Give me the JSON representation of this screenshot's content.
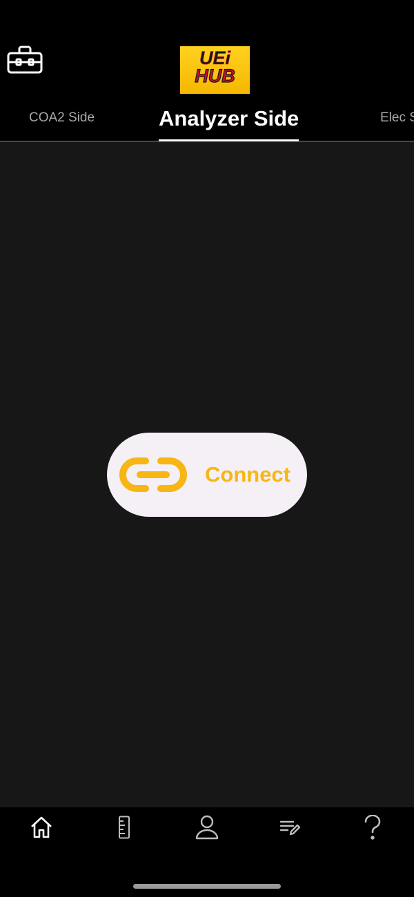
{
  "header": {
    "logo_line1": "UEi",
    "logo_line2": "HUB",
    "toolbox_icon": "toolbox-icon"
  },
  "tabs": [
    {
      "label": "COA2 Side",
      "active": false
    },
    {
      "label": "Analyzer Side",
      "active": true
    },
    {
      "label": "Elec S",
      "active": false
    }
  ],
  "main": {
    "connect_label": "Connect",
    "connect_icon": "link-icon"
  },
  "bottom_nav": [
    {
      "name": "home-icon",
      "active": true
    },
    {
      "name": "ruler-icon",
      "active": false
    },
    {
      "name": "person-icon",
      "active": false
    },
    {
      "name": "notes-edit-icon",
      "active": false
    },
    {
      "name": "help-icon",
      "active": false
    }
  ],
  "colors": {
    "accent": "#f7b614",
    "background": "#171717",
    "header": "#000000",
    "button_bg": "#f4f0f6",
    "inactive_tab": "#a9a9a9"
  }
}
